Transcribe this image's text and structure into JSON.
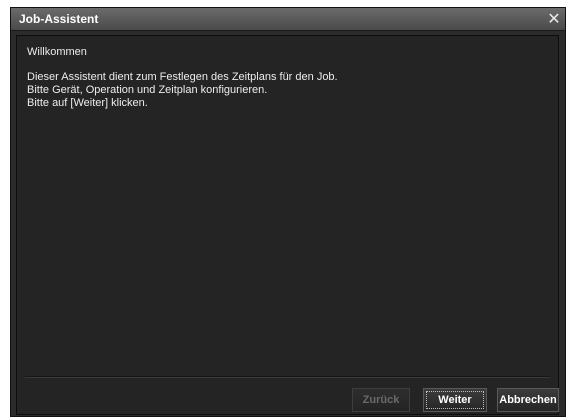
{
  "window": {
    "title": "Job-Assistent",
    "close_glyph": "✕",
    "close_icon": "close-icon"
  },
  "content": {
    "heading": "Willkommen",
    "lines": [
      "Dieser Assistent dient zum Festlegen des Zeitplans für den Job.",
      "Bitte Gerät, Operation und Zeitplan konfigurieren.",
      "Bitte auf [Weiter] klicken."
    ]
  },
  "buttons": {
    "back": "Zurück",
    "next": "Weiter",
    "cancel": "Abbrechen"
  },
  "colors": {
    "background": "#242424",
    "text": "#ededed",
    "disabled_text": "#6a6a6a"
  }
}
